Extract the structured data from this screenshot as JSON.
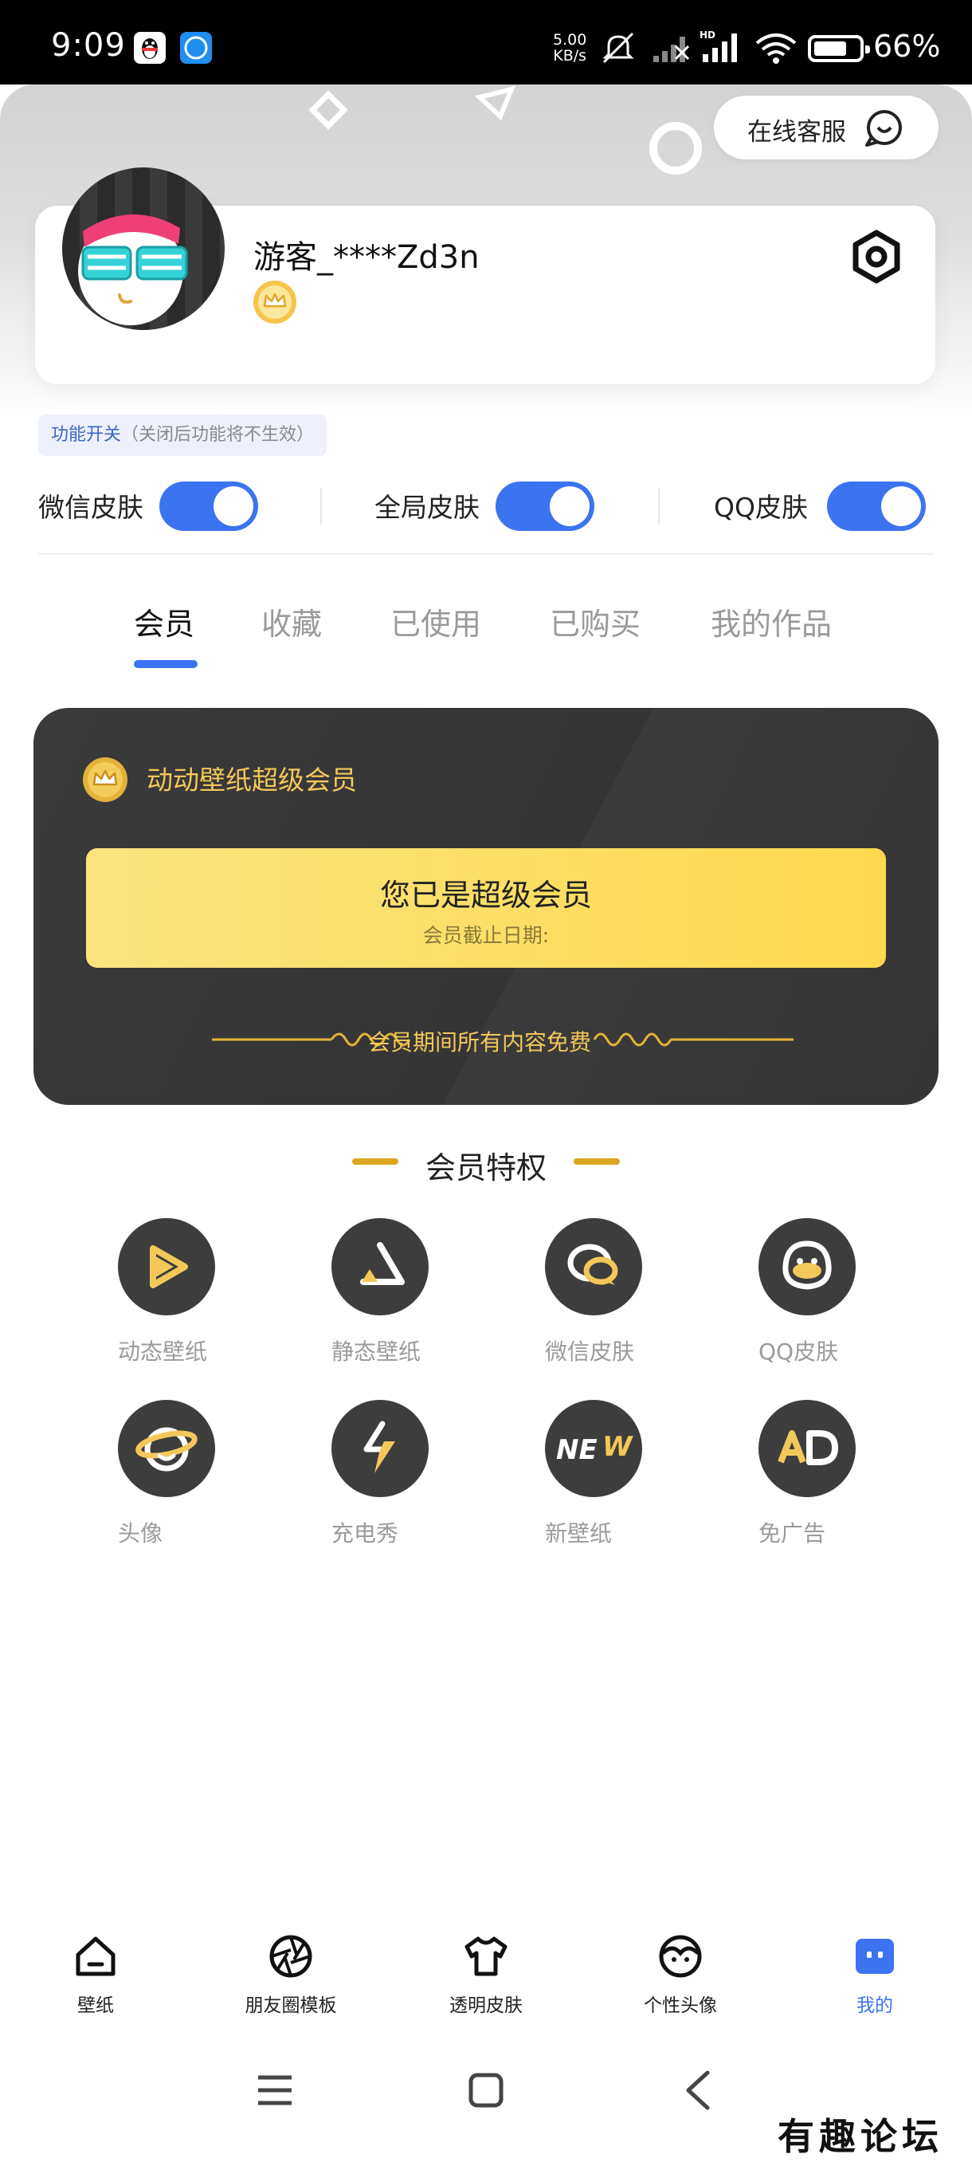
{
  "status_bar": {
    "time": "9:09",
    "net_speed_value": "5.00",
    "net_speed_unit": "KB/s",
    "network_badge": "HD",
    "battery": "66%",
    "icons": [
      "qq-notification-icon",
      "browser-notification-icon",
      "mute-icon",
      "signal-icon",
      "wifi-icon",
      "battery-icon"
    ]
  },
  "header": {
    "customer_service_label": "在线客服"
  },
  "profile": {
    "username": "游客_****Zd3n"
  },
  "feature_switches": {
    "tag_label": "功能开关",
    "tag_hint": "（关闭后功能将不生效）",
    "items": [
      {
        "label": "微信皮肤",
        "on": true
      },
      {
        "label": "全局皮肤",
        "on": true
      },
      {
        "label": "QQ皮肤",
        "on": true
      }
    ]
  },
  "tabs": [
    {
      "label": "会员",
      "active": true
    },
    {
      "label": "收藏",
      "active": false
    },
    {
      "label": "已使用",
      "active": false
    },
    {
      "label": "已购买",
      "active": false
    },
    {
      "label": "我的作品",
      "active": false
    }
  ],
  "member_card": {
    "title": "动动壁纸超级会员",
    "status": "您已是超级会员",
    "expiry_label": "会员截止日期:",
    "free_note": "会员期间所有内容免费"
  },
  "privileges": {
    "title": "会员特权",
    "items": [
      {
        "label": "动态壁纸",
        "icon": "play-icon"
      },
      {
        "label": "静态壁纸",
        "icon": "triangle-icon"
      },
      {
        "label": "微信皮肤",
        "icon": "wechat-icon"
      },
      {
        "label": "QQ皮肤",
        "icon": "qq-penguin-icon"
      },
      {
        "label": "头像",
        "icon": "planet-face-icon"
      },
      {
        "label": "充电秀",
        "icon": "lightning-icon"
      },
      {
        "label": "新壁纸",
        "icon": "new-icon"
      },
      {
        "label": "免广告",
        "icon": "ad-icon"
      }
    ]
  },
  "bottom_nav": [
    {
      "label": "壁纸",
      "icon": "home-icon",
      "active": false
    },
    {
      "label": "朋友圈模板",
      "icon": "aperture-icon",
      "active": false
    },
    {
      "label": "透明皮肤",
      "icon": "tshirt-icon",
      "active": false
    },
    {
      "label": "个性头像",
      "icon": "face-icon",
      "active": false
    },
    {
      "label": "我的",
      "icon": "profile-icon",
      "active": true
    }
  ],
  "colors": {
    "accent_blue": "#3b73f0",
    "gold": "#f3c85a",
    "card_dark": "#363636"
  },
  "watermark": "有趣论坛"
}
